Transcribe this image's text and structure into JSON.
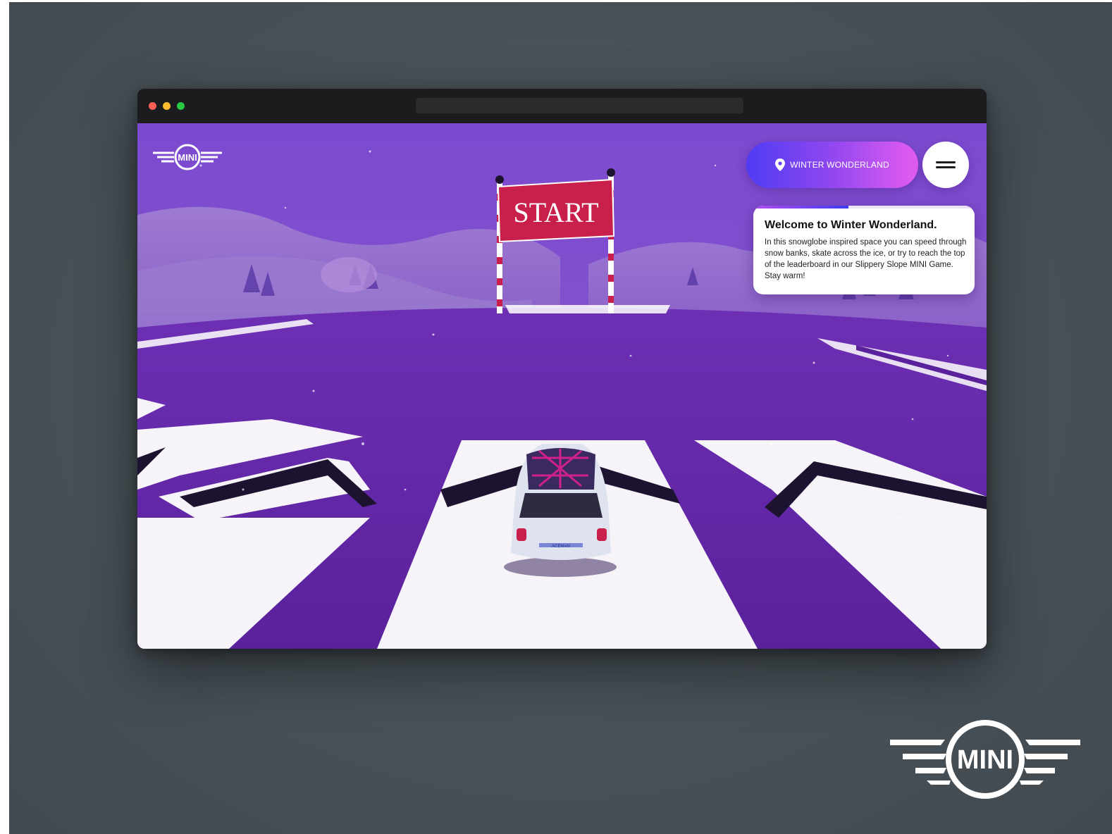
{
  "brand": {
    "logo_text": "MINI"
  },
  "browser": {
    "address_bar": ""
  },
  "scene": {
    "sign_text": "START",
    "car_badge": "ACEMAN"
  },
  "header": {
    "location_label": "WINTER WONDERLAND",
    "location_icon": "map-pin-icon",
    "menu_icon": "hamburger-menu-icon"
  },
  "info_card": {
    "title": "Welcome to Winter Wonderland.",
    "body": "In this snowglobe inspired space you can speed through snow banks, skate across the ice, or try to reach the top of the leaderboard in our Slippery Slope MINI Game. Stay warm!",
    "progress": 0.43
  },
  "colors": {
    "backdrop": "#485157",
    "sky_purple": "#7a45c9",
    "ground_purple": "#6a2eb0",
    "pill_start": "#4f3cf2",
    "pill_end": "#e45cf0",
    "sign_red": "#c8204a"
  }
}
